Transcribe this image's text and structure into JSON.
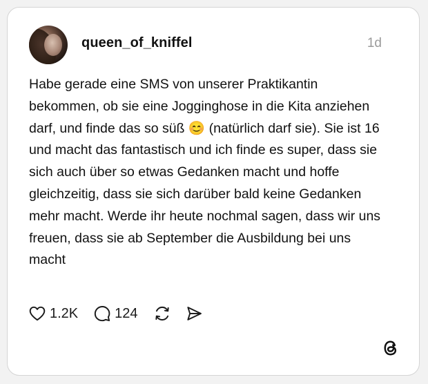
{
  "post": {
    "username": "queen_of_kniffel",
    "time": "1d",
    "text": "Habe gerade eine SMS von unserer Praktikantin bekommen, ob sie eine Jogginghose in die Kita anziehen darf, und finde das so süß 😊 (natürlich darf sie). Sie ist 16 und macht das fantastisch und ich finde es super, dass sie sich auch über so etwas Gedanken macht und hoffe gleichzeitig, dass sie sich darüber bald keine Gedanken mehr macht. Werde ihr heute nochmal sagen, dass wir uns freuen, dass sie ab September die Ausbildung bei uns macht"
  },
  "actions": {
    "likes": "1.2K",
    "replies": "124"
  },
  "icons": {
    "like": "heart-icon",
    "reply": "speech-bubble-icon",
    "repost": "repost-icon",
    "share": "send-icon",
    "brand": "threads-logo-icon"
  }
}
